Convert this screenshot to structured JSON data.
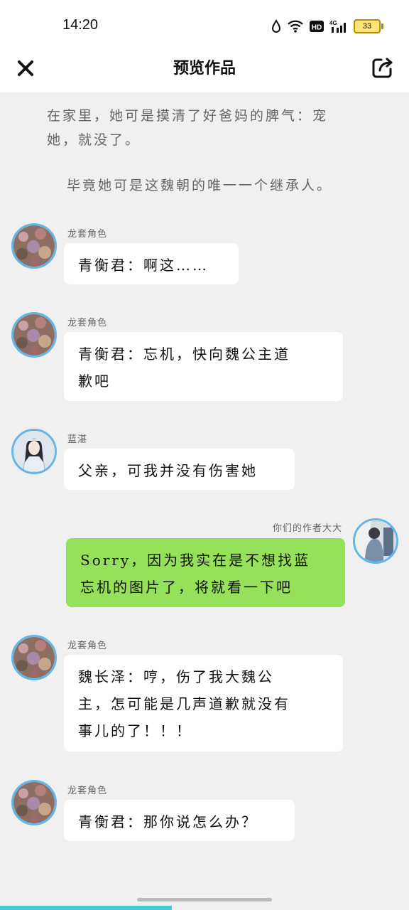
{
  "status_bar": {
    "time": "14:20",
    "battery": "33"
  },
  "header": {
    "title": "预览作品"
  },
  "narration": {
    "line1": "在家里，她可是摸清了好爸妈的脾气：宠",
    "line2": "她，就没了。",
    "line3": "毕竟她可是这魏朝的唯一一个继承人。"
  },
  "messages": [
    {
      "name": "龙套角色",
      "line1": "青衡君：啊这……"
    },
    {
      "name": "龙套角色",
      "line1": "青衡君：忘机，快向魏公主道",
      "line2": "歉吧"
    },
    {
      "name": "蓝湛",
      "line1": "父亲，可我并没有伤害她"
    },
    {
      "name": "你们的作者大大",
      "line1": "Sorry，因为我实在是不想找蓝",
      "line2": "忘机的图片了，将就看一下吧"
    },
    {
      "name": "龙套角色",
      "line1": "魏长泽：哼，伤了我大魏公",
      "line2": "主，怎可能是几声道歉就没有",
      "line3": "事儿的了！！！"
    },
    {
      "name": "龙套角色",
      "line1": "青衡君：那你说怎么办？"
    }
  ],
  "playback": {
    "progress_fraction": 0.42
  },
  "colors": {
    "self_bubble": "#95e15a",
    "avatar_ring": "#63b6ea",
    "progress": "#47c9d6"
  }
}
